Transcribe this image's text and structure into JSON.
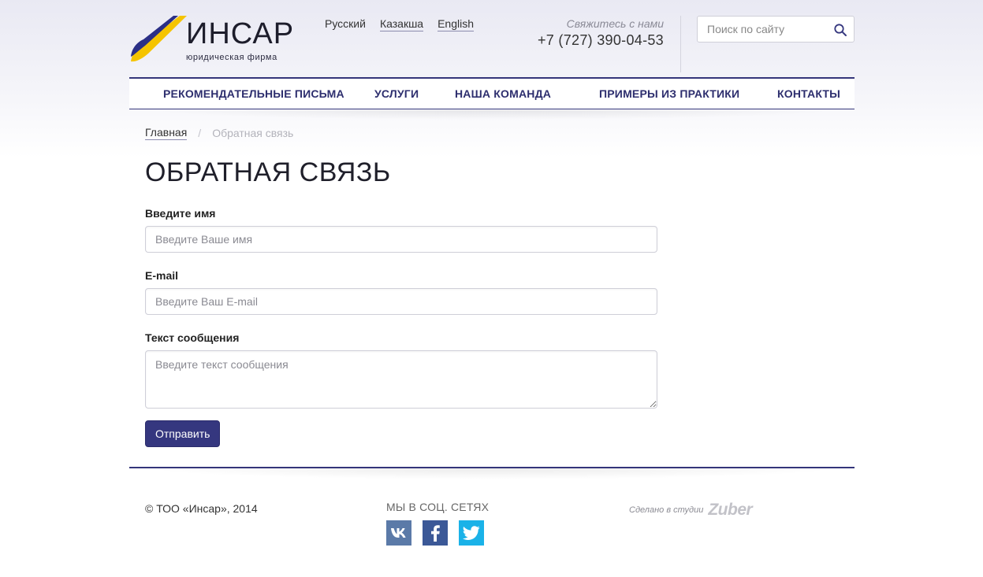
{
  "brand": {
    "name": "ИНСАР",
    "subtitle": "юридическая фирма",
    "colors": {
      "primary": "#35377f",
      "logo_yellow": "#f5c400",
      "logo_navy": "#2b2f86"
    }
  },
  "header": {
    "languages": [
      {
        "label": "Русский",
        "active": true
      },
      {
        "label": "Казакша",
        "active": false
      },
      {
        "label": "English",
        "active": false
      }
    ],
    "contact_label": "Свяжитесь с нами",
    "phone": "+7 (727) 390-04-53",
    "search": {
      "placeholder": "Поиск по сайту",
      "icon": "search-icon"
    }
  },
  "nav": {
    "items": [
      {
        "label": "РЕКОМЕНДАТЕЛЬНЫЕ ПИСЬМА"
      },
      {
        "label": "УСЛУГИ"
      },
      {
        "label": "НАША КОМАНДА"
      },
      {
        "label": "ПРИМЕРЫ ИЗ ПРАКТИКИ"
      },
      {
        "label": "КОНТАКТЫ"
      }
    ]
  },
  "breadcrumb": {
    "home": "Главная",
    "separator": "/",
    "current": "Обратная связь"
  },
  "page": {
    "title": "ОБРАТНАЯ СВЯЗЬ"
  },
  "form": {
    "name": {
      "label": "Введите имя",
      "placeholder": "Введите Ваше имя",
      "value": ""
    },
    "email": {
      "label": "E-mail",
      "placeholder": "Введите Ваш E-mail",
      "value": ""
    },
    "message": {
      "label": "Текст сообщения",
      "placeholder": "Введите текст сообщения",
      "value": ""
    },
    "submit_label": "Отправить"
  },
  "footer": {
    "copyright": "© ТОО «Инсар», 2014",
    "social_title": "МЫ В СОЦ. СЕТЯХ",
    "social": [
      {
        "icon": "vk-icon",
        "label": "VK",
        "color": "#5b7aa8"
      },
      {
        "icon": "facebook-icon",
        "label": "f",
        "color": "#3b5897"
      },
      {
        "icon": "twitter-icon",
        "label": "Twitter",
        "color": "#1ab2e8"
      }
    ],
    "studio_text": "Сделано в студии",
    "studio_name": "Zuber"
  }
}
